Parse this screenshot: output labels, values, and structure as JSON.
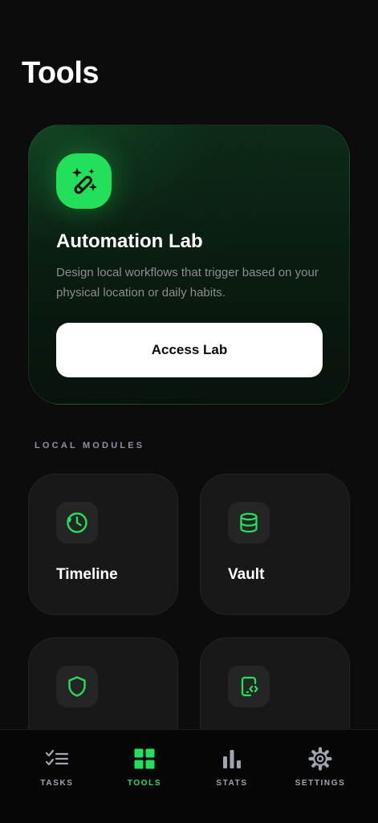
{
  "page": {
    "title": "Tools"
  },
  "hero": {
    "icon": "magic-wand-sparkles-icon",
    "title": "Automation Lab",
    "description": "Design local workflows that trigger based on your physical location or daily habits.",
    "button_label": "Access Lab"
  },
  "modules_section": {
    "label": "LOCAL MODULES",
    "items": [
      {
        "label": "Timeline",
        "icon": "clock-icon"
      },
      {
        "label": "Vault",
        "icon": "database-icon"
      },
      {
        "label": "",
        "icon": "shield-icon"
      },
      {
        "label": "",
        "icon": "mobile-code-icon"
      }
    ]
  },
  "tabbar": {
    "items": [
      {
        "label": "TASKS",
        "icon": "task-list-icon",
        "active": false
      },
      {
        "label": "TOOLS",
        "icon": "grid-icon",
        "active": true
      },
      {
        "label": "STATS",
        "icon": "bar-chart-icon",
        "active": false
      },
      {
        "label": "SETTINGS",
        "icon": "gear-icon",
        "active": false
      }
    ]
  },
  "colors": {
    "accent": "#22e05a",
    "background": "#0c0c0c",
    "card": "#181818",
    "muted_text": "#8b8d93",
    "tab_inactive": "#a0a6b2"
  }
}
